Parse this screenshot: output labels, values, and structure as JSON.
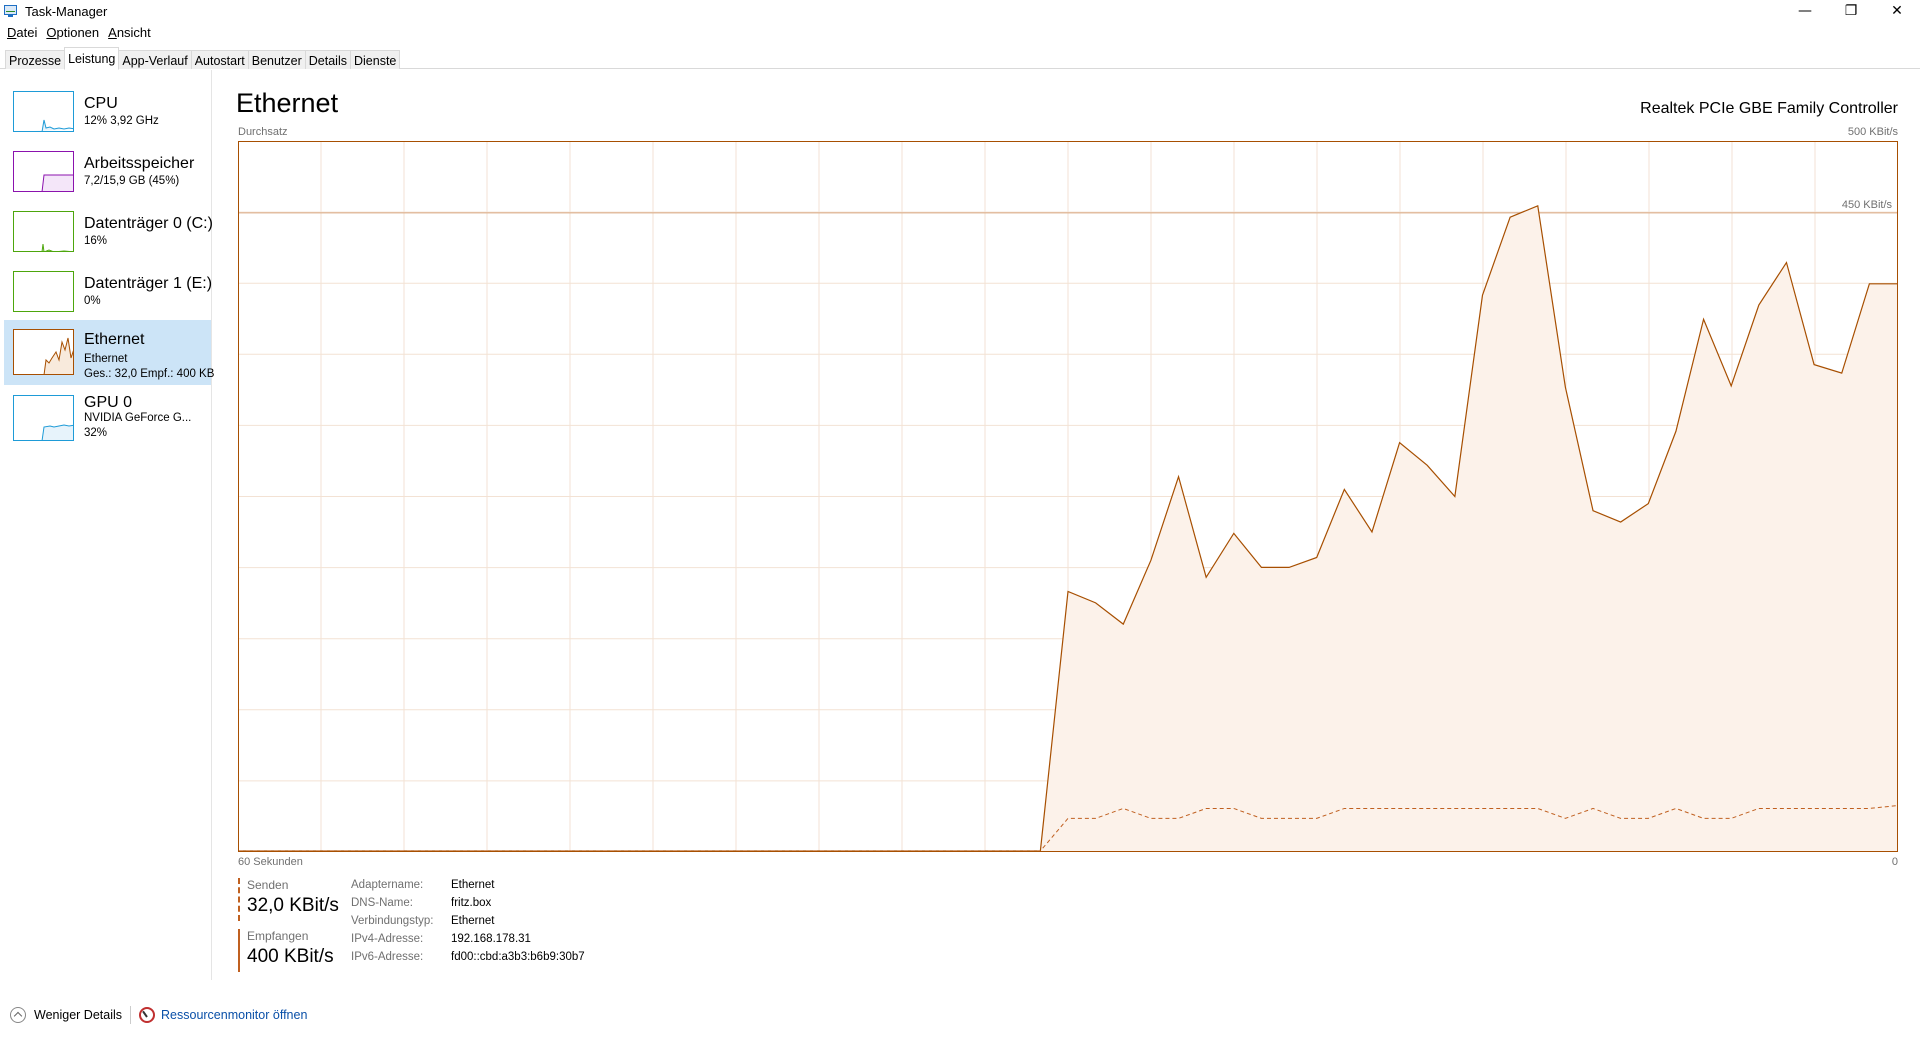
{
  "window": {
    "title": "Task-Manager",
    "minimize": "—",
    "maximize": "❐",
    "close": "✕"
  },
  "menu": [
    {
      "key": "D",
      "rest": "atei"
    },
    {
      "key": "O",
      "rest": "ptionen"
    },
    {
      "key": "A",
      "rest": "nsicht"
    }
  ],
  "tabs": [
    "Prozesse",
    "Leistung",
    "App-Verlauf",
    "Autostart",
    "Benutzer",
    "Details",
    "Dienste"
  ],
  "sidebar": {
    "items": [
      {
        "title": "CPU",
        "line1": "12% 3,92 GHz",
        "line2": "",
        "color": "#1e9bd7",
        "level": 0.12
      },
      {
        "title": "Arbeitsspeicher",
        "line1": "7,2/15,9 GB (45%)",
        "line2": "",
        "color": "#8b12ae",
        "level": 0.45
      },
      {
        "title": "Datenträger 0 (C:)",
        "line1": "16%",
        "line2": "",
        "color": "#4da60c",
        "level": 0.16
      },
      {
        "title": "Datenträger 1 (E:)",
        "line1": "0%",
        "line2": "",
        "color": "#4da60c",
        "level": 0
      },
      {
        "title": "Ethernet",
        "line1": "Ethernet",
        "line2": "Ges.: 32,0 Empf.: 400 KB",
        "color": "#a74f01",
        "level": 0.8
      },
      {
        "title": "GPU 0",
        "line1": "NVIDIA GeForce G...",
        "line2": "32%",
        "color": "#1e9bd7",
        "level": 0.32
      }
    ]
  },
  "main": {
    "title": "Ethernet",
    "device": "Realtek PCIe GBE Family Controller",
    "chart_top_label": "Durchsatz",
    "chart_max": "500 KBit/s",
    "chart_line_label": "450 KBit/s",
    "time_left": "60 Sekunden",
    "time_right": "0"
  },
  "stats": {
    "send_label": "Senden",
    "send_value": "32,0 KBit/s",
    "recv_label": "Empfangen",
    "recv_value": "400 KBit/s"
  },
  "props": [
    {
      "key": "Adaptername:",
      "value": "Ethernet"
    },
    {
      "key": "DNS-Name:",
      "value": "fritz.box"
    },
    {
      "key": "Verbindungstyp:",
      "value": "Ethernet"
    },
    {
      "key": "IPv4-Adresse:",
      "value": "192.168.178.31"
    },
    {
      "key": "IPv6-Adresse:",
      "value": "fd00::cbd:a3b3:b6b9:30b7"
    }
  ],
  "footer": {
    "fewer_details": "Weniger Details",
    "resmon": "Ressourcenmonitor öffnen"
  },
  "chart_data": {
    "type": "area",
    "ylim": [
      0,
      500
    ],
    "xlim": [
      60,
      0
    ],
    "scale_line": 450,
    "series": [
      {
        "name": "Empfangen",
        "x": [
          60,
          31,
          30,
          29,
          28,
          27,
          26,
          25,
          24,
          23,
          22,
          21,
          20,
          19,
          18,
          17,
          16,
          15,
          14,
          13,
          12,
          11,
          10,
          9,
          8,
          7,
          6,
          5,
          4,
          3,
          2,
          1,
          0
        ],
        "values": [
          0,
          0,
          183,
          175,
          160,
          205,
          264,
          193,
          224,
          200,
          200,
          207,
          255,
          225,
          288,
          272,
          250,
          392,
          447,
          455,
          327,
          240,
          232,
          245,
          296,
          375,
          328,
          385,
          415,
          343,
          337,
          400,
          400
        ]
      },
      {
        "name": "Senden",
        "x": [
          60,
          31,
          30,
          29,
          28,
          27,
          26,
          25,
          24,
          23,
          22,
          21,
          20,
          19,
          18,
          17,
          16,
          15,
          14,
          13,
          12,
          11,
          10,
          9,
          8,
          7,
          6,
          5,
          4,
          3,
          2,
          1,
          0
        ],
        "values": [
          0,
          0,
          23,
          23,
          30,
          23,
          23,
          30,
          30,
          23,
          23,
          23,
          30,
          30,
          30,
          30,
          30,
          30,
          30,
          30,
          23,
          30,
          23,
          23,
          30,
          23,
          23,
          30,
          30,
          30,
          30,
          30,
          32
        ]
      }
    ]
  }
}
